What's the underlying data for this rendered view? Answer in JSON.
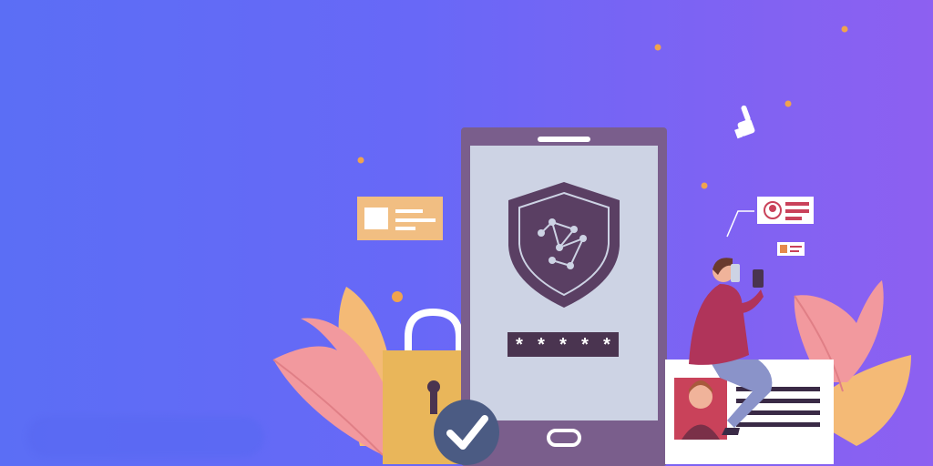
{
  "hero": {
    "title": "",
    "subtitle": "",
    "cta_label": ""
  },
  "illustration": {
    "password_mask": "* * * * *",
    "icons": [
      "shield-icon",
      "padlock-icon",
      "checkmark-icon",
      "pointer-hand-icon",
      "id-card-icon"
    ]
  },
  "colors": {
    "background_start": "#5b6ef5",
    "background_end": "#8d60f1",
    "phone_frame": "#7a5e8c",
    "phone_screen": "#cdd3e4",
    "shield": "#5a3f63",
    "lock_body": "#e9b65a",
    "check_circle": "#4b5b83",
    "leaf_pink": "#f2999e",
    "leaf_orange": "#f4ba76"
  }
}
